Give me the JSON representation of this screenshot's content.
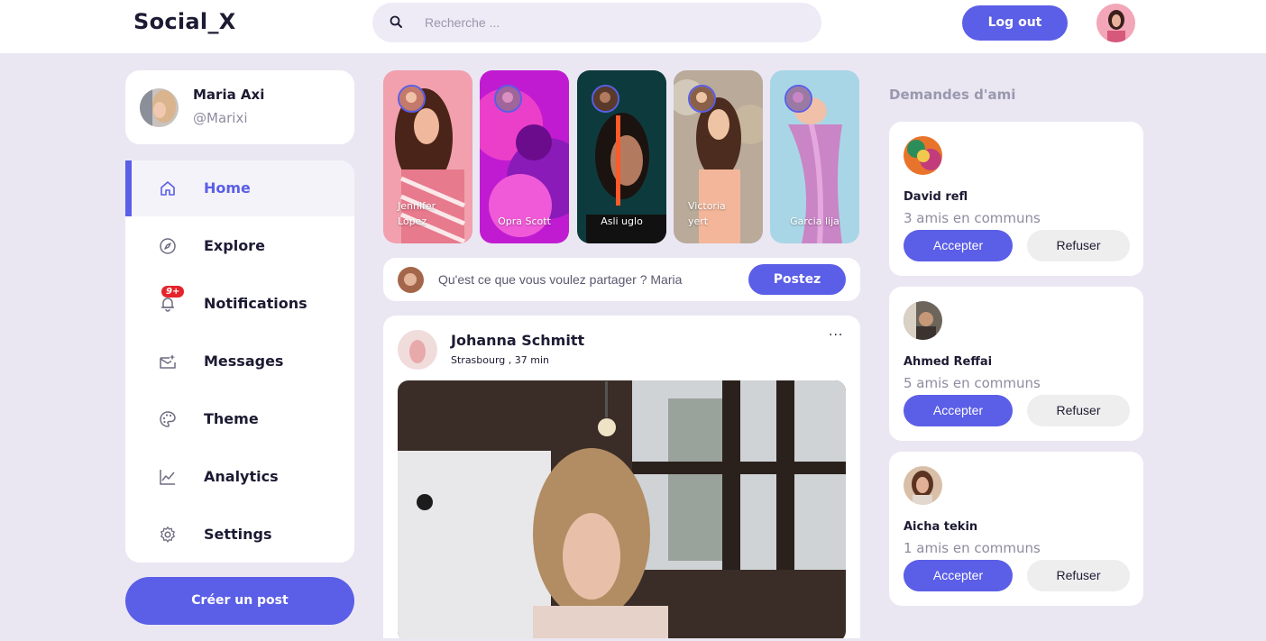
{
  "header": {
    "logo": "Social_X",
    "search_placeholder": "Recherche ...",
    "logout_label": "Log out"
  },
  "profile": {
    "name": "Maria Axi",
    "handle": "@Marixi"
  },
  "sidebar": {
    "items": [
      {
        "label": "Home",
        "icon": "home-icon",
        "active": true
      },
      {
        "label": "Explore",
        "icon": "compass-icon"
      },
      {
        "label": "Notifications",
        "icon": "bell-icon",
        "badge": "9+"
      },
      {
        "label": "Messages",
        "icon": "messages-icon"
      },
      {
        "label": "Theme",
        "icon": "palette-icon"
      },
      {
        "label": "Analytics",
        "icon": "analytics-icon"
      },
      {
        "label": "Settings",
        "icon": "gear-icon"
      }
    ],
    "create_post_label": "Créer un post"
  },
  "stories": [
    {
      "name": "Jennifer\nLopez"
    },
    {
      "name": "Opra Scott"
    },
    {
      "name": "Asli uglo"
    },
    {
      "name": "Victoria\nyert"
    },
    {
      "name": "Garcia lija"
    }
  ],
  "composer": {
    "placeholder": "Qu'est ce que vous voulez partager ? Maria",
    "post_label": "Postez"
  },
  "feed": {
    "post": {
      "author": "Johanna Schmitt",
      "meta": "Strasbourg , 37 min",
      "more": "···"
    }
  },
  "friend_requests": {
    "title": "Demandes d'ami",
    "accept_label": "Accepter",
    "refuse_label": "Refuser",
    "items": [
      {
        "name": "David refl",
        "mutual": "3 amis en communs"
      },
      {
        "name": "Ahmed Reffai",
        "mutual": "5 amis en communs"
      },
      {
        "name": "Aicha tekin",
        "mutual": "1 amis en communs"
      }
    ]
  },
  "colors": {
    "accent": "#5b5ee6",
    "background": "#eae7f3",
    "badge": "#e5232b"
  }
}
